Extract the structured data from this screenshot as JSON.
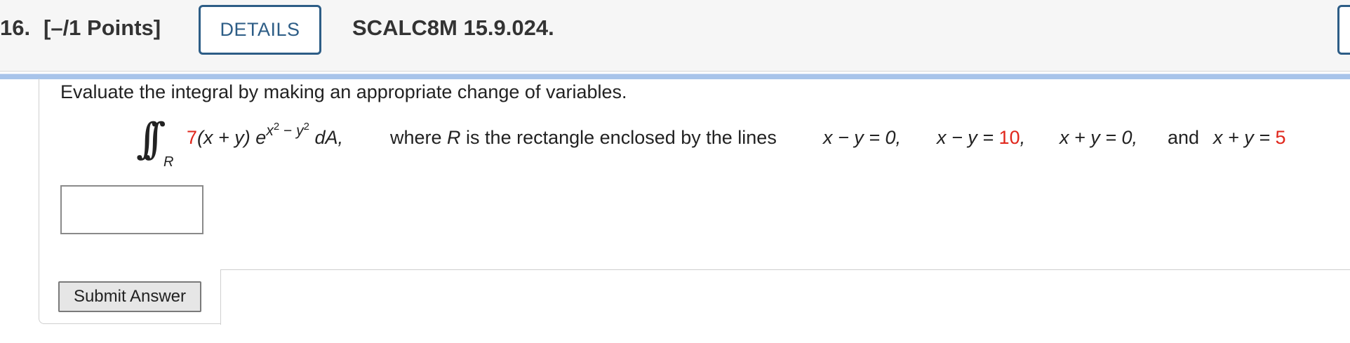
{
  "header": {
    "question_number": "16.",
    "points": "[–/1 Points]",
    "details_label": "DETAILS",
    "problem_code": "SCALC8M 15.9.024."
  },
  "problem": {
    "instruction": "Evaluate the integral by making an appropriate change of variables.",
    "integral": {
      "sign": "∫∫",
      "region_subscript": "R",
      "coefficient": "7",
      "factor": "(x + y) e",
      "exponent_x": "x",
      "exponent_sq1": "2",
      "exponent_minus": " − ",
      "exponent_y": "y",
      "exponent_sq2": "2",
      "differential": " dA,"
    },
    "where_text_1": "where ",
    "where_R": "R",
    "where_text_2": " is the rectangle enclosed by the lines",
    "line1": "x − y = 0,",
    "line2_lhs": "x − y = ",
    "line2_value": "10",
    "line2_end": ",",
    "line3": "x + y = 0,",
    "and_text": "and",
    "line4_lhs": "x + y = ",
    "line4_value": "5"
  },
  "answer": {
    "value": "",
    "placeholder": ""
  },
  "submit": {
    "label": "Submit Answer"
  },
  "colors": {
    "accent_blue": "#2d5d86",
    "divider_blue": "#a8c4ea",
    "value_red": "#e0261b"
  }
}
